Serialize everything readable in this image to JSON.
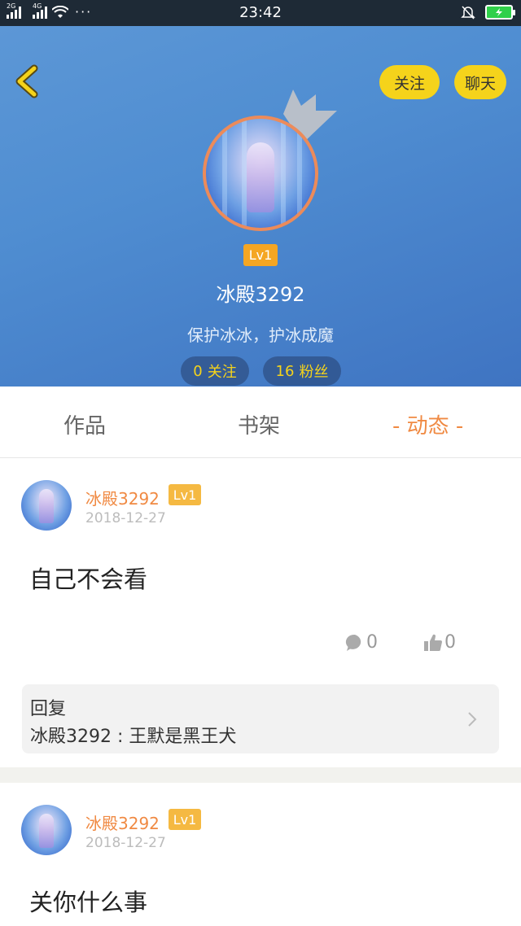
{
  "status_bar": {
    "network_1": "2G",
    "network_2": "4G",
    "time": "23:42",
    "dots": "···",
    "icons": [
      "signal-icon",
      "wifi-icon",
      "bell-off-icon",
      "battery-charging-icon"
    ]
  },
  "header": {
    "follow_button": "关注",
    "chat_button": "聊天",
    "level": "Lv1",
    "name": "冰殿3292",
    "bio": "保护冰冰，护冰成魔",
    "following_count": "0",
    "following_label": "关注",
    "fans_count": "16",
    "fans_label": "粉丝"
  },
  "tabs": {
    "works": "作品",
    "shelf": "书架",
    "dynamic": "- 动态 -",
    "active": "dynamic"
  },
  "posts": [
    {
      "author": "冰殿3292",
      "level": "Lv1",
      "date": "2018-12-27",
      "content": "自己不会看",
      "comments": "0",
      "likes": "0",
      "reply_label": "回复",
      "reply_text": "冰殿3292 : 王默是黑王犬"
    },
    {
      "author": "冰殿3292",
      "level": "Lv1",
      "date": "2018-12-27",
      "content": "关你什么事"
    }
  ],
  "colors": {
    "accent_orange": "#f08a43",
    "button_yellow": "#f5d31b",
    "level_badge": "#f5a623",
    "header_blue": "#4f8dd1"
  }
}
